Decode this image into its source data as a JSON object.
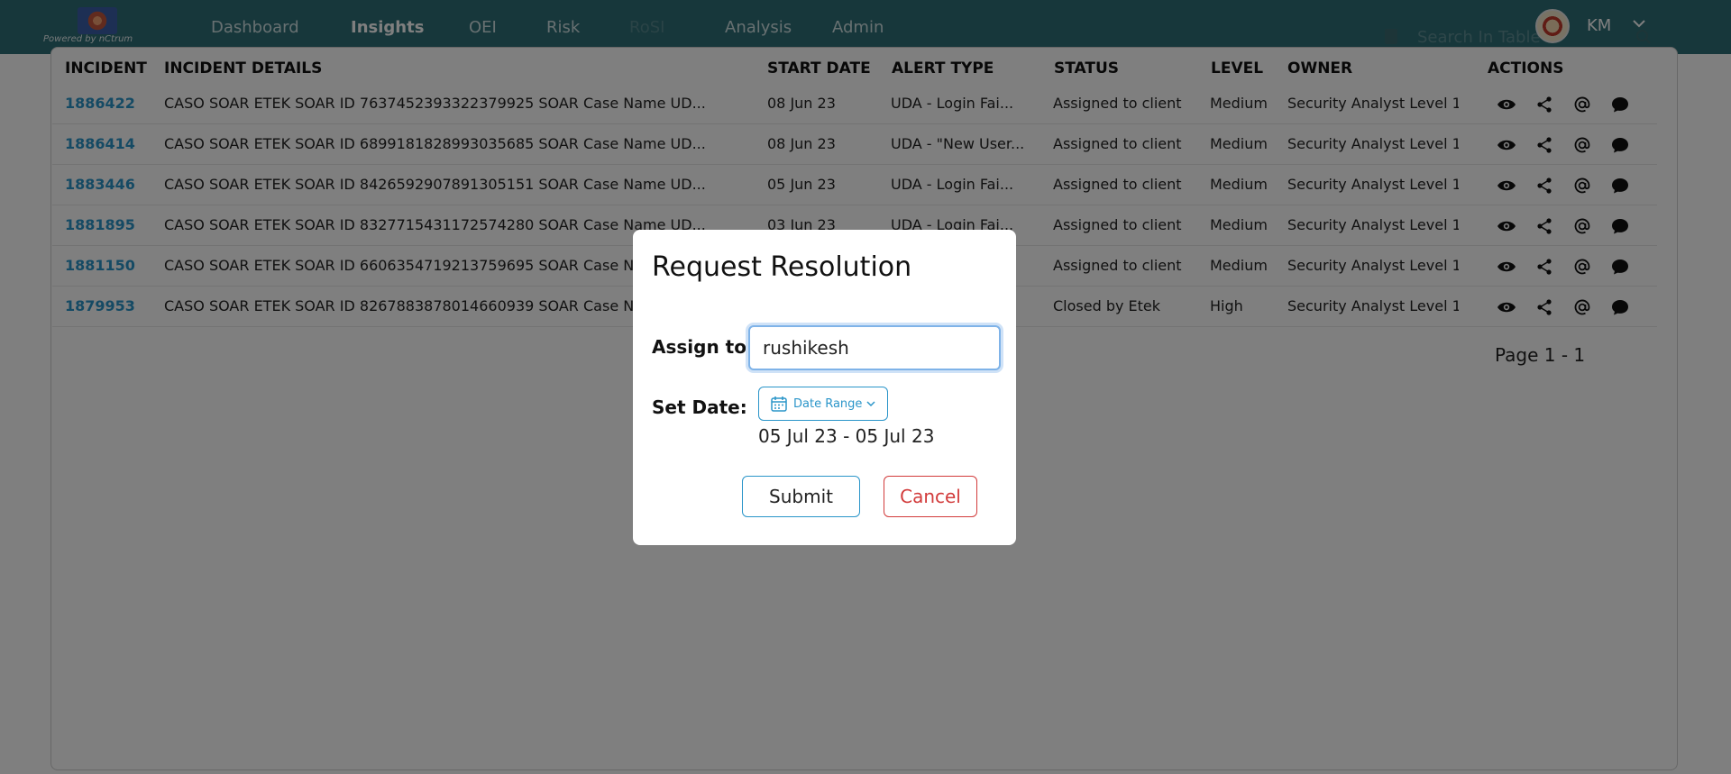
{
  "brand": {
    "caption": "Powered by nCtrum"
  },
  "nav": {
    "items": [
      "Dashboard",
      "Insights",
      "OEI",
      "Risk",
      "RoSI",
      "Analysis",
      "Admin"
    ],
    "active": "Insights"
  },
  "user": {
    "initials": "KM"
  },
  "search": {
    "placeholder": "Search In Table"
  },
  "table": {
    "headers": [
      "INCIDENT",
      "INCIDENT DETAILS",
      "START DATE",
      "ALERT TYPE",
      "STATUS",
      "LEVEL",
      "OWNER",
      "ACTIONS"
    ],
    "rows": [
      {
        "incident": "1886422",
        "details": "CASO SOAR ETEK SOAR ID 7637452393322379925 SOAR Case Name UD...",
        "start_date": "08 Jun 23",
        "alert_type": "UDA - Login Fai...",
        "status": "Assigned to client",
        "level": "Medium",
        "owner": "Security Analyst Level 1"
      },
      {
        "incident": "1886414",
        "details": "CASO SOAR ETEK SOAR ID 6899181828993035685 SOAR Case Name UD...",
        "start_date": "08 Jun 23",
        "alert_type": "UDA - \"New User...",
        "status": "Assigned to client",
        "level": "Medium",
        "owner": "Security Analyst Level 1"
      },
      {
        "incident": "1883446",
        "details": "CASO SOAR ETEK SOAR ID 8426592907891305151 SOAR Case Name UD...",
        "start_date": "05 Jun 23",
        "alert_type": "UDA - Login Fai...",
        "status": "Assigned to client",
        "level": "Medium",
        "owner": "Security Analyst Level 1"
      },
      {
        "incident": "1881895",
        "details": "CASO SOAR ETEK SOAR ID 8327715431172574280 SOAR Case Name UD...",
        "start_date": "03 Jun 23",
        "alert_type": "UDA - Login Fai...",
        "status": "Assigned to client",
        "level": "Medium",
        "owner": "Security Analyst Level 1"
      },
      {
        "incident": "1881150",
        "details": "CASO SOAR ETEK SOAR ID 6606354719213759695 SOAR Case Name UD...",
        "start_date": "",
        "alert_type": "",
        "status": "Assigned to client",
        "level": "Medium",
        "owner": "Security Analyst Level 1"
      },
      {
        "incident": "1879953",
        "details": "CASO SOAR ETEK SOAR ID 8267883878014660939 SOAR Case Name UD...",
        "start_date": "",
        "alert_type": "...",
        "status": "Closed by Etek",
        "level": "High",
        "owner": "Security Analyst Level 1"
      }
    ],
    "pager": "Page 1 - 1"
  },
  "modal": {
    "title": "Request Resolution",
    "assign_label": "Assign to:",
    "assign_value": "rushikesh",
    "date_label": "Set Date:",
    "date_button": "Date Range",
    "date_range": "05 Jul 23 - 05 Jul 23",
    "submit": "Submit",
    "cancel": "Cancel"
  },
  "icons": {
    "actions": [
      "eye-icon",
      "share-icon",
      "at-icon",
      "chat-icon"
    ]
  },
  "colors": {
    "nav_bg": "#2f6f77",
    "link": "#2a95c9",
    "cancel": "#d23b3b"
  }
}
